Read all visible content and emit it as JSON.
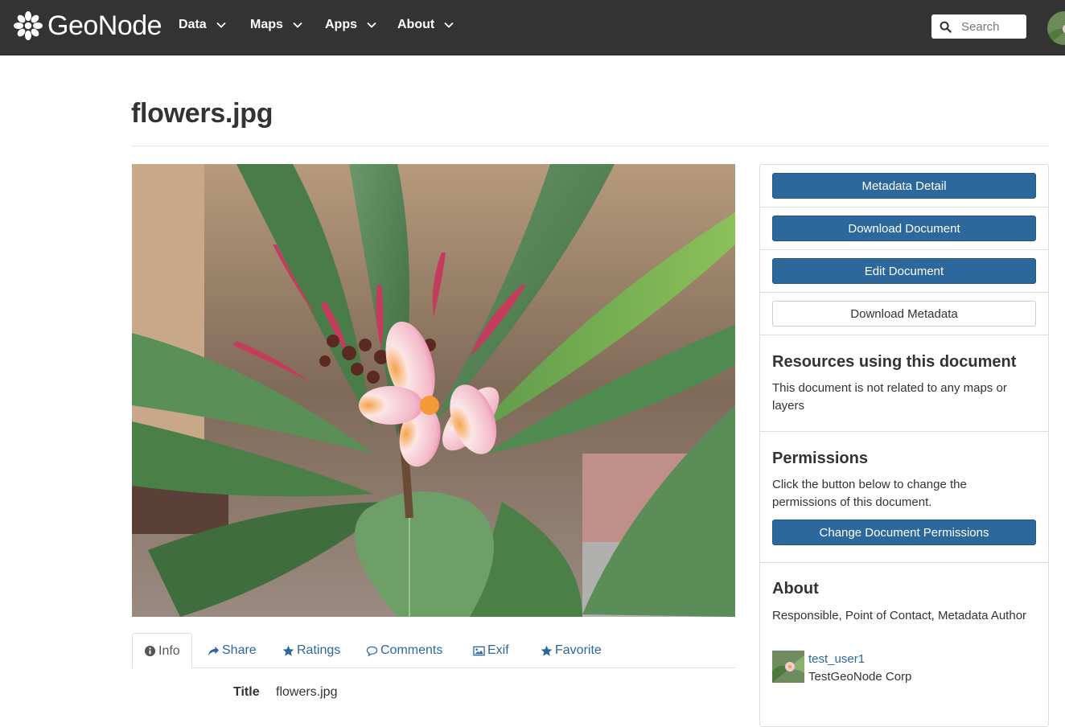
{
  "navbar": {
    "brand": "GeoNode",
    "menu": [
      {
        "label": "Data"
      },
      {
        "label": "Maps"
      },
      {
        "label": "Apps"
      },
      {
        "label": "About"
      }
    ],
    "search_placeholder": "Search"
  },
  "page": {
    "title": "flowers.jpg"
  },
  "tabs": [
    {
      "label": "Info",
      "icon": "info-icon",
      "active": true
    },
    {
      "label": "Share",
      "icon": "share-icon"
    },
    {
      "label": "Ratings",
      "icon": "star-icon"
    },
    {
      "label": "Comments",
      "icon": "comment-icon"
    },
    {
      "label": "Exif",
      "icon": "image-icon"
    },
    {
      "label": "Favorite",
      "icon": "star-icon"
    }
  ],
  "info": {
    "title_label": "Title",
    "title_value": "flowers.jpg"
  },
  "sidebar": {
    "metadata_detail": "Metadata Detail",
    "download_document": "Download Document",
    "edit_document": "Edit Document",
    "download_metadata": "Download Metadata",
    "resources_heading": "Resources using this document",
    "resources_text": "This document is not related to any maps or layers",
    "permissions_heading": "Permissions",
    "permissions_text": "Click the button below to change the permissions of this document.",
    "change_permissions": "Change Document Permissions",
    "about_heading": "About",
    "about_roles": "Responsible, Point of Contact, Metadata Author",
    "owner_name": "test_user1",
    "owner_org": "TestGeoNode Corp"
  },
  "colors": {
    "navbar_bg": "#333333",
    "primary": "#2c689c",
    "link": "#2c689c"
  }
}
